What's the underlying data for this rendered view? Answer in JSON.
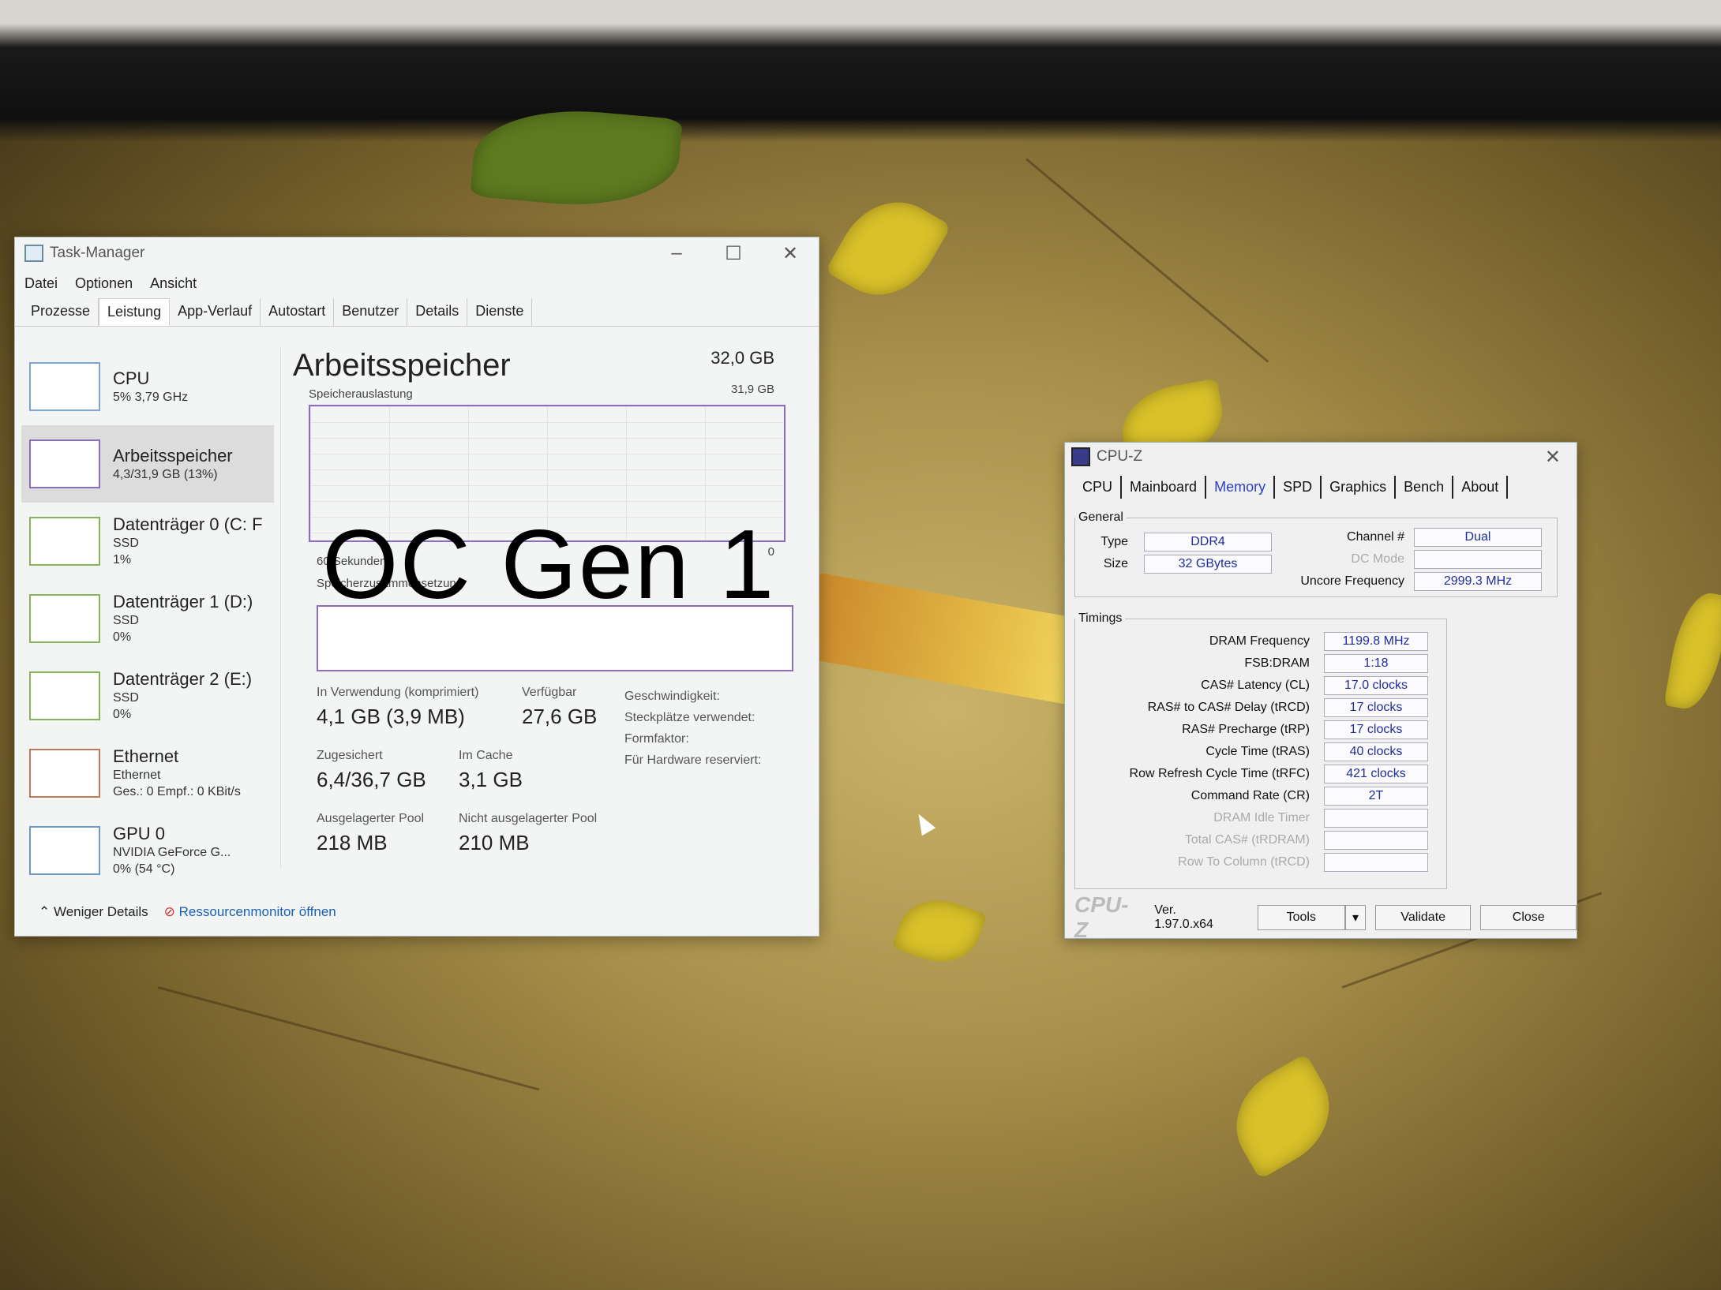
{
  "taskmanager": {
    "title": "Task-Manager",
    "menu": [
      "Datei",
      "Optionen",
      "Ansicht"
    ],
    "tabs": [
      "Prozesse",
      "Leistung",
      "App-Verlauf",
      "Autostart",
      "Benutzer",
      "Details",
      "Dienste"
    ],
    "active_tab": "Leistung",
    "sidebar": [
      {
        "name": "CPU",
        "sub1": "5% 3,79 GHz",
        "sub2": "",
        "sub3": ""
      },
      {
        "name": "Arbeitsspeicher",
        "sub1": "4,3/31,9 GB (13%)",
        "sub2": "",
        "sub3": ""
      },
      {
        "name": "Datenträger 0 (C: F",
        "sub1": "SSD",
        "sub2": "1%",
        "sub3": ""
      },
      {
        "name": "Datenträger 1 (D:)",
        "sub1": "SSD",
        "sub2": "0%",
        "sub3": ""
      },
      {
        "name": "Datenträger 2 (E:)",
        "sub1": "SSD",
        "sub2": "0%",
        "sub3": ""
      },
      {
        "name": "Ethernet",
        "sub1": "Ethernet",
        "sub2": "Ges.: 0 Empf.: 0 KBit/s",
        "sub3": ""
      },
      {
        "name": "GPU 0",
        "sub1": "NVIDIA GeForce G...",
        "sub2": "0% (54 °C)",
        "sub3": ""
      }
    ],
    "main": {
      "title": "Arbeitsspeicher",
      "capacity": "32,0 GB",
      "usage_label": "Speicherauslastung",
      "usage_max": "31,9 GB",
      "seconds_label": "60 Sekunden",
      "zero": "0",
      "composition_label": "Speicherzusammensetzung",
      "in_use_label": "In Verwendung (komprimiert)",
      "in_use_value": "4,1 GB (3,9 MB)",
      "available_label": "Verfügbar",
      "available_value": "27,6 GB",
      "committed_label": "Zugesichert",
      "committed_value": "6,4/36,7 GB",
      "cached_label": "Im Cache",
      "cached_value": "3,1 GB",
      "paged_label": "Ausgelagerter Pool",
      "paged_value": "218 MB",
      "nonpaged_label": "Nicht ausgelagerter Pool",
      "nonpaged_value": "210 MB",
      "speed_label": "Geschwindigkeit:",
      "slots_label": "Steckplätze verwendet:",
      "form_label": "Formfaktor:",
      "reserved_label": "Für Hardware reserviert:"
    },
    "footer": {
      "less": "Weniger Details",
      "resmon": "Ressourcenmonitor öffnen"
    }
  },
  "overlay_text": "OC Gen 1",
  "cpuz": {
    "title": "CPU-Z",
    "tabs": [
      "CPU",
      "Mainboard",
      "Memory",
      "SPD",
      "Graphics",
      "Bench",
      "About"
    ],
    "active_tab": "Memory",
    "general": {
      "legend": "General",
      "type_label": "Type",
      "type_value": "DDR4",
      "size_label": "Size",
      "size_value": "32 GBytes",
      "channel_label": "Channel #",
      "channel_value": "Dual",
      "dcmode_label": "DC Mode",
      "dcmode_value": "",
      "uncore_label": "Uncore Frequency",
      "uncore_value": "2999.3 MHz"
    },
    "timings": {
      "legend": "Timings",
      "rows": [
        {
          "label": "DRAM Frequency",
          "value": "1199.8 MHz",
          "dim": false
        },
        {
          "label": "FSB:DRAM",
          "value": "1:18",
          "dim": false
        },
        {
          "label": "CAS# Latency (CL)",
          "value": "17.0 clocks",
          "dim": false
        },
        {
          "label": "RAS# to CAS# Delay (tRCD)",
          "value": "17 clocks",
          "dim": false
        },
        {
          "label": "RAS# Precharge (tRP)",
          "value": "17 clocks",
          "dim": false
        },
        {
          "label": "Cycle Time (tRAS)",
          "value": "40 clocks",
          "dim": false
        },
        {
          "label": "Row Refresh Cycle Time (tRFC)",
          "value": "421 clocks",
          "dim": false
        },
        {
          "label": "Command Rate (CR)",
          "value": "2T",
          "dim": false
        },
        {
          "label": "DRAM Idle Timer",
          "value": "",
          "dim": true
        },
        {
          "label": "Total CAS# (tRDRAM)",
          "value": "",
          "dim": true
        },
        {
          "label": "Row To Column (tRCD)",
          "value": "",
          "dim": true
        }
      ]
    },
    "brand": "CPU-Z",
    "version": "Ver. 1.97.0.x64",
    "tools_label": "Tools",
    "validate_label": "Validate",
    "close_label": "Close"
  }
}
